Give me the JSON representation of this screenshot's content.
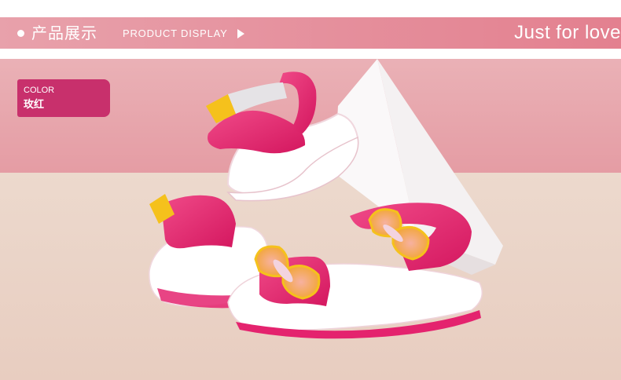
{
  "header": {
    "title_cn": "产品展示",
    "title_en": "PRODUCT DISPLAY",
    "slogan": "Just for love",
    "bullet_icon": "circle-bullet-icon",
    "arrow_icon": "play-triangle-icon"
  },
  "product": {
    "color_label": "COLOR",
    "color_value": "玫红",
    "image_alt": "product-photo-pink-sandals"
  },
  "colors": {
    "header_bg": "#e58f9c",
    "tag_bg": "#c8306c",
    "sandal_pink": "#e5236f",
    "butterfly_yellow": "#f5c11c"
  }
}
